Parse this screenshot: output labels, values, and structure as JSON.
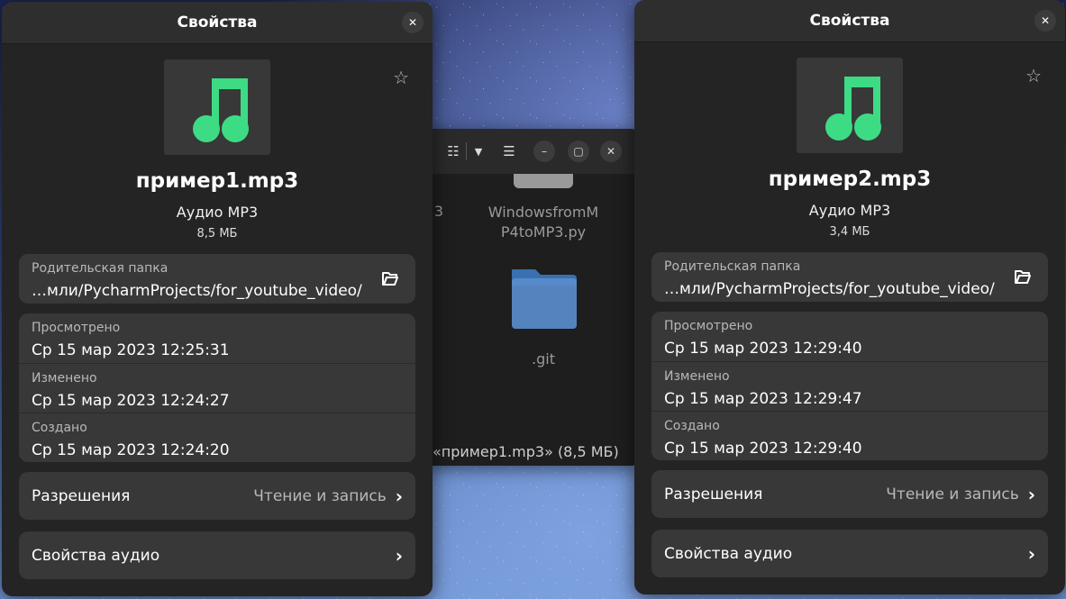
{
  "background_window": {
    "partial_left_text": "3",
    "file_name": "WindowsfromMP4toMP3.py",
    "file_name_line1": "WindowsfromM",
    "file_name_line2": "P4toMP3.py",
    "folder_name": ".git",
    "status": "«пример1.mp3» (8,5 МБ)",
    "folder_color": "#4a7fc1"
  },
  "dialogs": [
    {
      "title": "Свойства",
      "file_name": "пример1.mp3",
      "file_type": "Аудио MP3",
      "file_size": "8,5 МБ",
      "parent_folder_label": "Родительская папка",
      "parent_folder_value": "…мли/PycharmProjects/for_youtube_video/",
      "viewed_label": "Просмотрено",
      "viewed_value": "Ср 15 мар 2023 12:25:31",
      "modified_label": "Изменено",
      "modified_value": "Ср 15 мар 2023 12:24:27",
      "created_label": "Создано",
      "created_value": "Ср 15 мар 2023 12:24:20",
      "permissions_label": "Разрешения",
      "permissions_value": "Чтение и запись",
      "audio_props_label": "Свойства аудио"
    },
    {
      "title": "Свойства",
      "file_name": "пример2.mp3",
      "file_type": "Аудио MP3",
      "file_size": "3,4 МБ",
      "parent_folder_label": "Родительская папка",
      "parent_folder_value": "…мли/PycharmProjects/for_youtube_video/",
      "viewed_label": "Просмотрено",
      "viewed_value": "Ср 15 мар 2023 12:29:40",
      "modified_label": "Изменено",
      "modified_value": "Ср 15 мар 2023 12:29:47",
      "created_label": "Создано",
      "created_value": "Ср 15 мар 2023 12:29:40",
      "permissions_label": "Разрешения",
      "permissions_value": "Чтение и запись",
      "audio_props_label": "Свойства аудио"
    }
  ],
  "icons": {
    "close": "close-icon",
    "star": "star-icon",
    "music": "music-note-icon",
    "open_folder": "folder-open-icon",
    "chevron": "chevron-right-icon"
  },
  "colors": {
    "music_icon": "#3ddc84",
    "dialog_bg": "#242424",
    "card_bg": "#383838"
  }
}
